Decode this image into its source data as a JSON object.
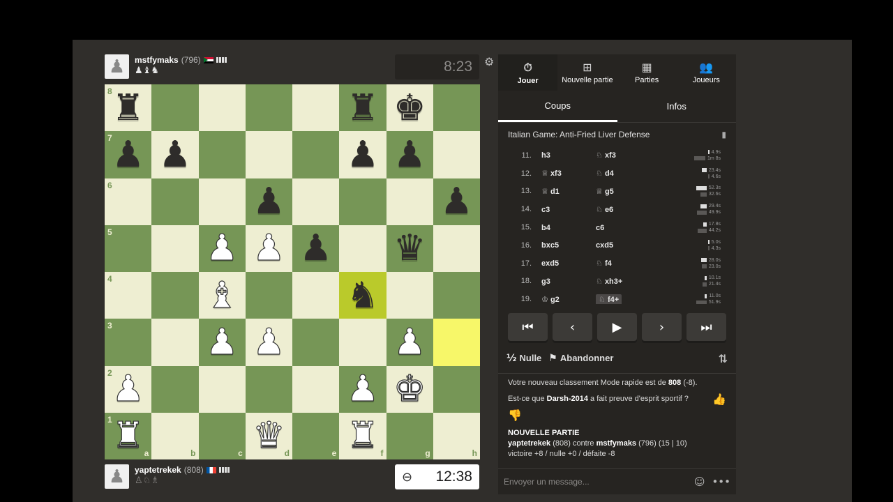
{
  "top_player": {
    "name": "mstfymaks",
    "rating": "(796)",
    "captured": "♟♝♞"
  },
  "bottom_player": {
    "name": "yaptetrekek",
    "rating": "(808)",
    "captured": "♙♘♗"
  },
  "clocks": {
    "top": "8:23",
    "bottom": "12:38"
  },
  "board": {
    "ranks": [
      [
        "r",
        "",
        "",
        "",
        "",
        "r",
        "k",
        ""
      ],
      [
        "p",
        "p",
        "",
        "",
        "",
        "p",
        "p",
        ""
      ],
      [
        "",
        "",
        "",
        "p",
        "",
        "",
        "",
        "p"
      ],
      [
        "",
        "",
        "P",
        "P",
        "p",
        "",
        "q",
        ""
      ],
      [
        "",
        "",
        "B",
        "",
        "",
        "n",
        "",
        ""
      ],
      [
        "",
        "",
        "P",
        "P",
        "",
        "",
        "P",
        ""
      ],
      [
        "P",
        "",
        "",
        "",
        "",
        "P",
        "K",
        ""
      ],
      [
        "R",
        "",
        "",
        "Q",
        "",
        "R",
        "",
        ""
      ]
    ],
    "rank_labels": [
      "8",
      "7",
      "6",
      "5",
      "4",
      "3",
      "2",
      "1"
    ],
    "file_labels": [
      "a",
      "b",
      "c",
      "d",
      "e",
      "f",
      "g",
      "h"
    ],
    "highlights": [
      "f4",
      "h3"
    ]
  },
  "nav": [
    {
      "label": "Jouer",
      "icon": "stopwatch-icon",
      "glyph": "⏱"
    },
    {
      "label": "Nouvelle partie",
      "icon": "plus-icon",
      "glyph": "⊞"
    },
    {
      "label": "Parties",
      "icon": "chessboard-icon",
      "glyph": "▦"
    },
    {
      "label": "Joueurs",
      "icon": "users-icon",
      "glyph": "👥"
    }
  ],
  "tabs": [
    "Coups",
    "Infos"
  ],
  "opening": "Italian Game: Anti-Fried Liver Defense",
  "moves": [
    {
      "num": "11.",
      "white": "h3",
      "white_fig": "",
      "black": "xf3",
      "black_fig": "♘",
      "wt": "4.9s",
      "bt": "1m 8s"
    },
    {
      "num": "12.",
      "white": "xf3",
      "white_fig": "♕",
      "black": "d4",
      "black_fig": "♘",
      "wt": "23.4s",
      "bt": "4.6s"
    },
    {
      "num": "13.",
      "white": "d1",
      "white_fig": "♕",
      "black": "g5",
      "black_fig": "♕",
      "wt": "52.3s",
      "bt": "32.6s"
    },
    {
      "num": "14.",
      "white": "c3",
      "white_fig": "",
      "black": "e6",
      "black_fig": "♘",
      "wt": "29.4s",
      "bt": "49.9s"
    },
    {
      "num": "15.",
      "white": "b4",
      "white_fig": "",
      "black": "c6",
      "black_fig": "",
      "wt": "17.8s",
      "bt": "44.2s"
    },
    {
      "num": "16.",
      "white": "bxc5",
      "white_fig": "",
      "black": "cxd5",
      "black_fig": "",
      "wt": "5.0s",
      "bt": "4.3s"
    },
    {
      "num": "17.",
      "white": "exd5",
      "white_fig": "",
      "black": "f4",
      "black_fig": "♘",
      "wt": "28.0s",
      "bt": "23.0s"
    },
    {
      "num": "18.",
      "white": "g3",
      "white_fig": "",
      "black": "xh3+",
      "black_fig": "♘",
      "wt": "10.1s",
      "bt": "21.4s"
    },
    {
      "num": "19.",
      "white": "g2",
      "white_fig": "♔",
      "black": "f4+",
      "black_fig": "♘",
      "wt": "11.0s",
      "bt": "51.9s"
    }
  ],
  "controls": [
    "⏮",
    "‹",
    "▶",
    "›",
    "⏭"
  ],
  "actions": {
    "draw": "Nulle",
    "draw_icon": "½",
    "resign": "Abandonner"
  },
  "chat": {
    "rating_msg_prefix": "Votre nouveau classement Mode rapide est de ",
    "rating_value": "808",
    "rating_change": " (-8).",
    "sport_prefix": "Est-ce que ",
    "sport_name": "Darsh-2014",
    "sport_suffix": " a fait preuve d'esprit sportif ?",
    "new_game_title": "NOUVELLE PARTIE",
    "ng_white": "yaptetrekek",
    "ng_white_rating": " (808) contre ",
    "ng_black": "mstfymaks",
    "ng_black_rating": " (796) (15 | 10)",
    "ng_result": "victoire +8 / nulle +0 / défaite -8",
    "placeholder": "Envoyer un message..."
  }
}
